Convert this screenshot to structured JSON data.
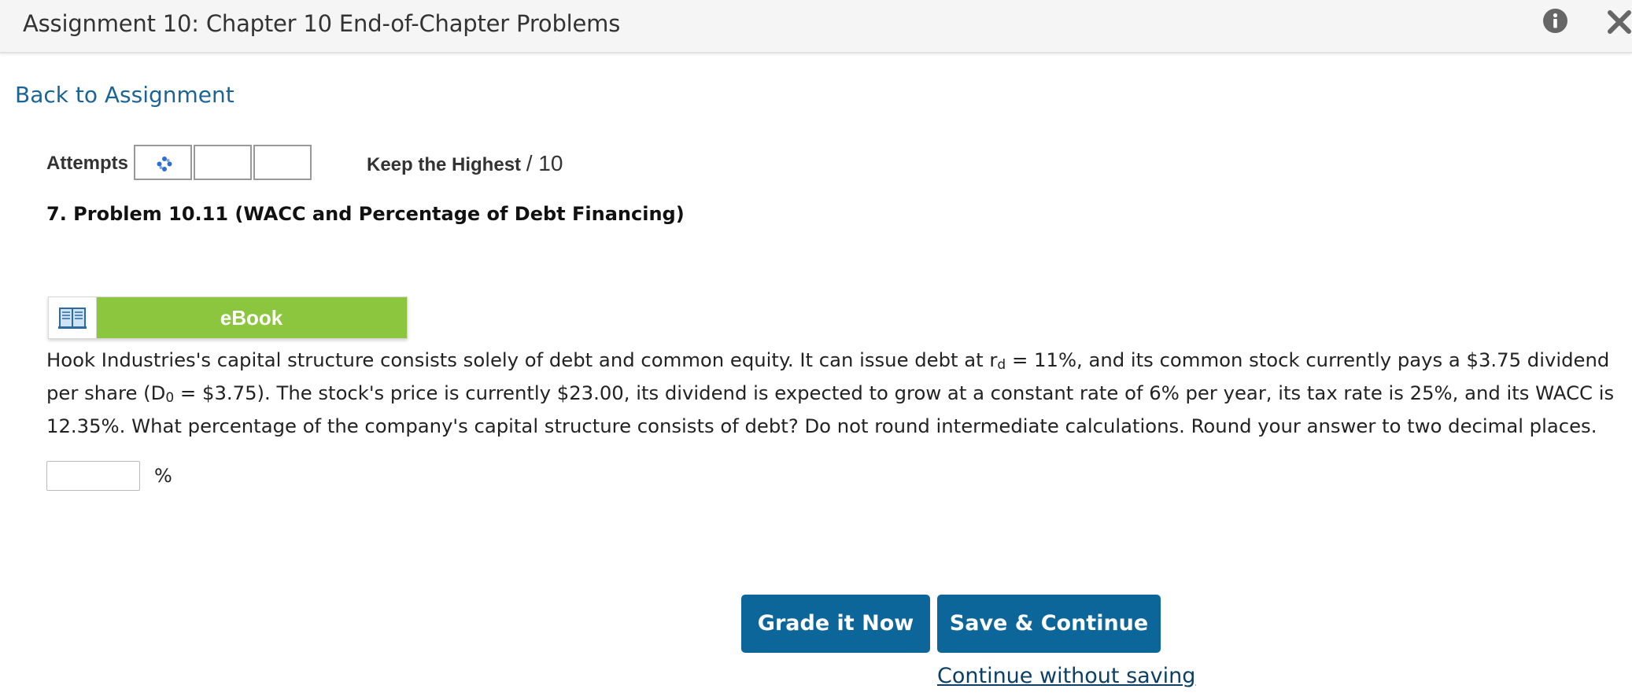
{
  "header": {
    "title": "Assignment 10: Chapter 10 End-of-Chapter Problems",
    "info_icon": "info-circle-icon",
    "close_icon": "close-x-icon"
  },
  "navigation": {
    "back_link": "Back to Assignment"
  },
  "attempts": {
    "label": "Attempts",
    "boxes_count_shown": 3,
    "first_box_icon": "loading-spinner-icon",
    "policy_label": "Keep the Highest",
    "score_out_of": "/ 10"
  },
  "problem": {
    "title": "7. Problem 10.11 (WACC and Percentage of Debt Financing)"
  },
  "ebook": {
    "icon": "open-book-icon",
    "label": "eBook",
    "accent_color": "#8cc63f"
  },
  "question": {
    "part1": "Hook Industries's capital structure consists solely of debt and common equity. It can issue debt at r",
    "sub1": "d",
    "part2": " = 11%, and its common stock currently pays a $3.75 dividend per share (D",
    "sub2": "0",
    "part3": " = $3.75). The stock's price is currently $23.00, its dividend is expected to grow at a constant rate of 6% per year, its tax rate is 25%, and its WACC is 12.35%. What percentage of the company's capital structure consists of debt? Do not round intermediate calculations. Round your answer to two decimal places."
  },
  "answer": {
    "value": "",
    "unit": "%"
  },
  "actions": {
    "grade_button": "Grade it Now",
    "save_button": "Save & Continue",
    "continue_link": "Continue without saving",
    "button_color": "#0c6699"
  }
}
